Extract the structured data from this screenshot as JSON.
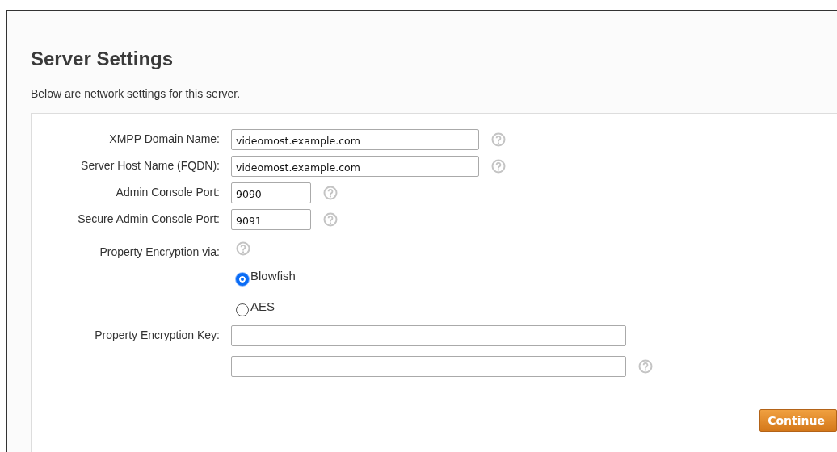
{
  "page": {
    "title": "Server Settings",
    "description": "Below are network settings for this server."
  },
  "rows": [
    {
      "kind": "host",
      "label": "XMPP Domain Name:",
      "inputs": [
        {
          "value": "videomost.example.com",
          "help": true
        }
      ]
    },
    {
      "kind": "host",
      "label": "Server Host Name (FQDN):",
      "inputs": [
        {
          "value": "videomost.example.com",
          "help": true
        }
      ]
    },
    {
      "kind": "port",
      "label": "Admin Console Port:",
      "inputs": [
        {
          "value": "9090",
          "help": true
        }
      ]
    },
    {
      "kind": "port",
      "label": "Secure Admin Console Port:",
      "inputs": [
        {
          "value": "9091",
          "help": true
        }
      ]
    },
    {
      "kind": "radio",
      "label": "Property Encryption via:",
      "help": true,
      "options": [
        {
          "label": "Blowfish",
          "selected": true
        },
        {
          "label": "AES",
          "selected": false
        }
      ]
    },
    {
      "kind": "key",
      "label": "Property Encryption Key:",
      "inputs": [
        {
          "help": false
        },
        {
          "help": true
        }
      ]
    }
  ],
  "buttons": [
    {
      "label": "Continue"
    }
  ]
}
